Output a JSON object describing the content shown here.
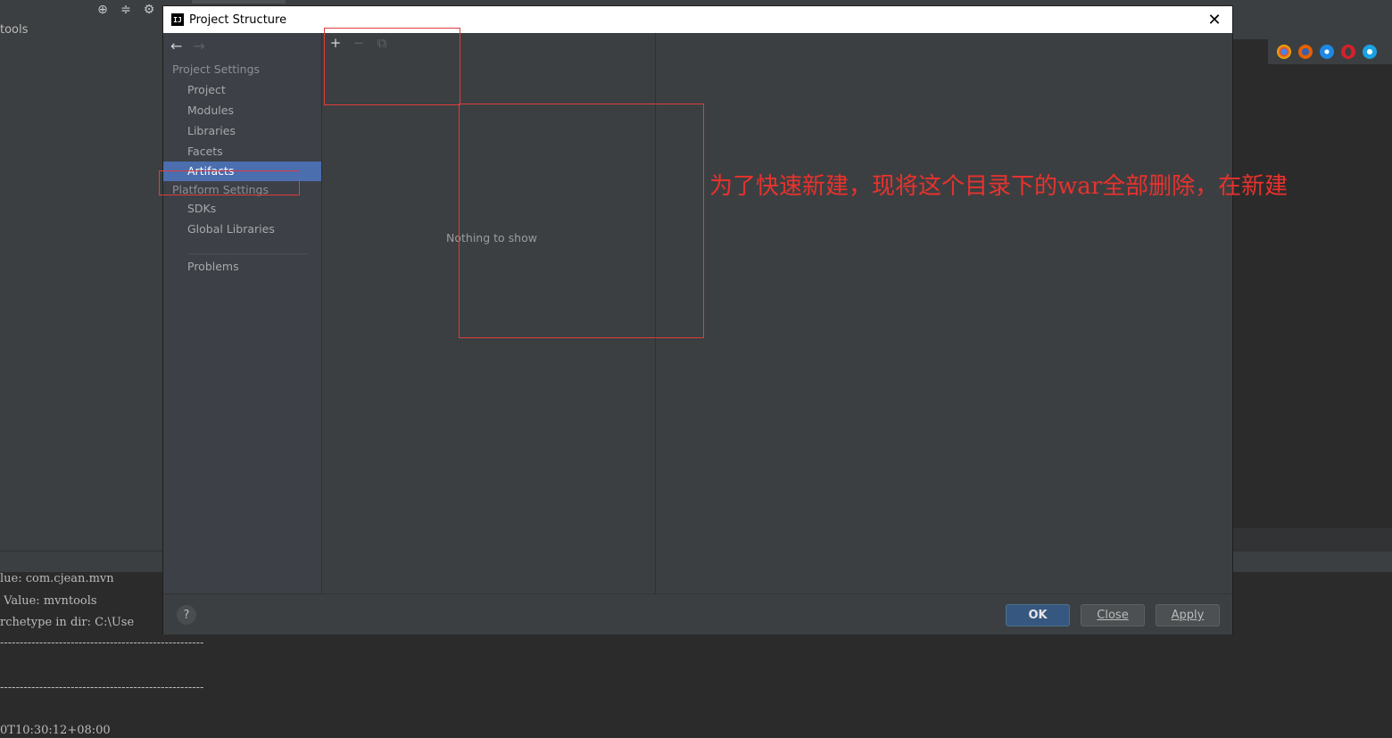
{
  "ide": {
    "left_label": "tools",
    "console_lines": [
      "lue: com.cjean.mvn",
      " Value: mvntools",
      "rchetype in dir: C:\\Use",
      "----------------------------------------------------",
      "",
      "----------------------------------------------------",
      "",
      "0T10:30:12+08:00"
    ]
  },
  "dialog": {
    "title": "Project Structure",
    "app_icon": "IJ",
    "close_glyph": "✕"
  },
  "sidebar": {
    "back_arrow": "←",
    "forward_arrow": "→",
    "project_settings_header": "Project Settings",
    "project_items": [
      {
        "label": "Project"
      },
      {
        "label": "Modules"
      },
      {
        "label": "Libraries"
      },
      {
        "label": "Facets"
      },
      {
        "label": "Artifacts",
        "selected": true
      }
    ],
    "platform_settings_header": "Platform Settings",
    "platform_items": [
      {
        "label": "SDKs"
      },
      {
        "label": "Global Libraries"
      }
    ],
    "problems_label": "Problems"
  },
  "toolbar": {
    "add_glyph": "+",
    "remove_glyph": "−",
    "copy_glyph": "⧉"
  },
  "artifacts_list": {
    "empty_text": "Nothing to show"
  },
  "footer": {
    "help_glyph": "?",
    "ok_label": "OK",
    "close_label": "Close",
    "apply_label": "Apply"
  },
  "annotation": {
    "text": "为了快速新建，现将这个目录下的war全部删除，在新建",
    "color": "#e8322d"
  },
  "colors": {
    "selection": "#4b6eaf",
    "ok_button": "#365880",
    "annotation_red": "#e03c3c"
  }
}
